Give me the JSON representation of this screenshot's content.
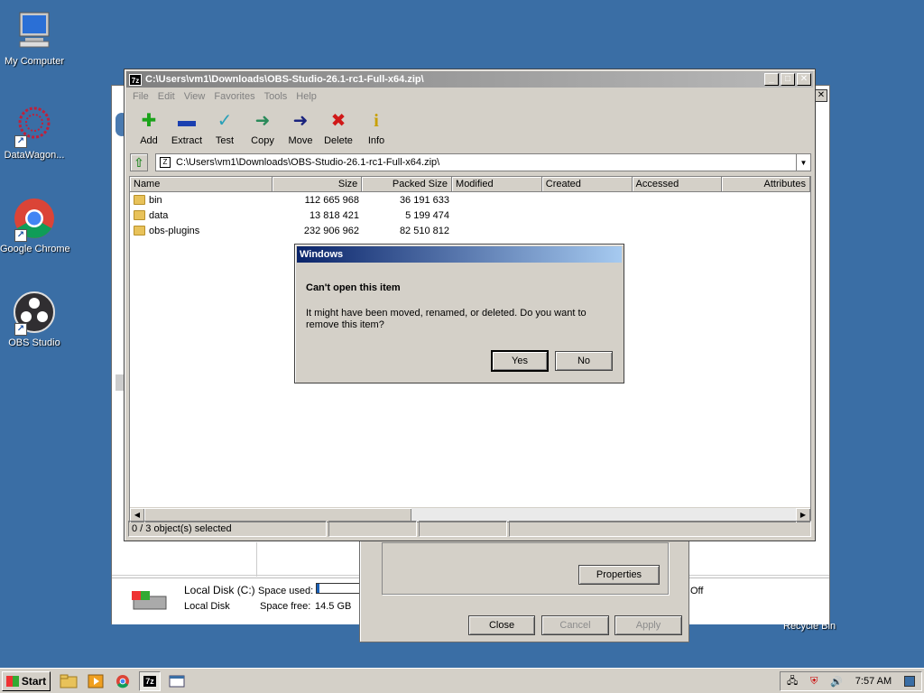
{
  "desktop": {
    "icons": [
      {
        "label": "My Computer",
        "icon": "computer-icon"
      },
      {
        "label": "DataWagon...",
        "icon": "datawagon-icon"
      },
      {
        "label": "Google Chrome",
        "icon": "chrome-icon"
      },
      {
        "label": "OBS Studio",
        "icon": "obs-icon"
      }
    ],
    "recycle_bin_label": "Recycle Bin"
  },
  "background_window": {
    "drive_name": "Local Disk (C:)",
    "drive_type": "Local Disk",
    "space_used_label": "Space used:",
    "space_free_label": "Space free:",
    "space_free_value": "14.5 GB",
    "off_text": "Off"
  },
  "properties_dialog": {
    "properties_button": "Properties",
    "close_button": "Close",
    "cancel_button": "Cancel",
    "apply_button": "Apply"
  },
  "zip_window": {
    "title": "C:\\Users\\vm1\\Downloads\\OBS-Studio-26.1-rc1-Full-x64.zip\\",
    "app_icon_text": "7z",
    "menu": [
      "File",
      "Edit",
      "View",
      "Favorites",
      "Tools",
      "Help"
    ],
    "toolbar": [
      {
        "label": "Add",
        "icon": "add-icon",
        "glyph": "✚",
        "color": "#1aa31a"
      },
      {
        "label": "Extract",
        "icon": "extract-icon",
        "glyph": "▬",
        "color": "#1a3fb0"
      },
      {
        "label": "Test",
        "icon": "test-icon",
        "glyph": "✓",
        "color": "#2aa0b8"
      },
      {
        "label": "Copy",
        "icon": "copy-icon",
        "glyph": "➜",
        "color": "#2a8a5a"
      },
      {
        "label": "Move",
        "icon": "move-icon",
        "glyph": "➜",
        "color": "#1a237e"
      },
      {
        "label": "Delete",
        "icon": "delete-icon",
        "glyph": "✖",
        "color": "#d01818"
      },
      {
        "label": "Info",
        "icon": "info-icon",
        "glyph": "i",
        "color": "#c8a000"
      }
    ],
    "address": "C:\\Users\\vm1\\Downloads\\OBS-Studio-26.1-rc1-Full-x64.zip\\",
    "columns": [
      "Name",
      "Size",
      "Packed Size",
      "Modified",
      "Created",
      "Accessed",
      "Attributes"
    ],
    "rows": [
      {
        "name": "bin",
        "size": "112 665 968",
        "packed": "36 191 633"
      },
      {
        "name": "data",
        "size": "13 818 421",
        "packed": "5 199 474"
      },
      {
        "name": "obs-plugins",
        "size": "232 906 962",
        "packed": "82 510 812"
      }
    ],
    "status": "0 / 3 object(s) selected"
  },
  "message_box": {
    "title": "Windows",
    "heading": "Can't open this item",
    "body": "It might have been moved, renamed, or deleted. Do you want to remove this item?",
    "yes_button": "Yes",
    "no_button": "No"
  },
  "taskbar": {
    "start_label": "Start",
    "app_7z_label": "7z",
    "clock": "7:57 AM"
  }
}
